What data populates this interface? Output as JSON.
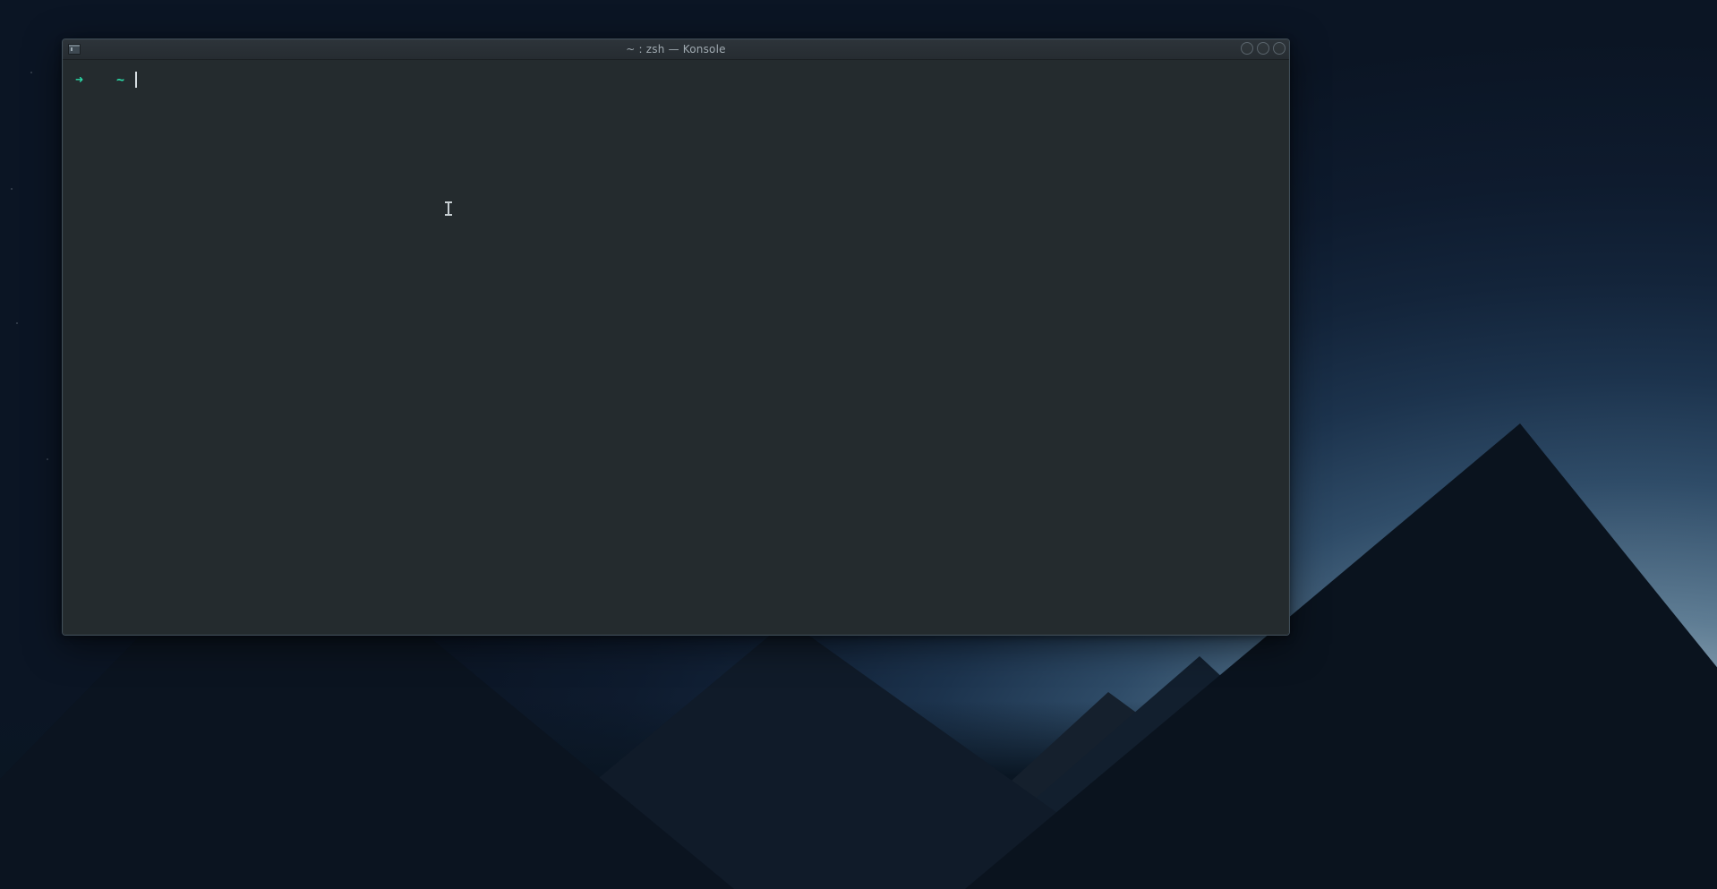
{
  "window": {
    "title": "~ : zsh — Konsole",
    "app_icon": "terminal-icon"
  },
  "terminal": {
    "prompt_arrow": "➜",
    "prompt_cwd": "~",
    "command_value": "",
    "command_placeholder": ""
  },
  "colors": {
    "prompt_accent": "#2bd9a6",
    "terminal_bg": "#242b2e",
    "titlebar_bg": "#2a3136",
    "title_text": "#9fa9b0"
  }
}
